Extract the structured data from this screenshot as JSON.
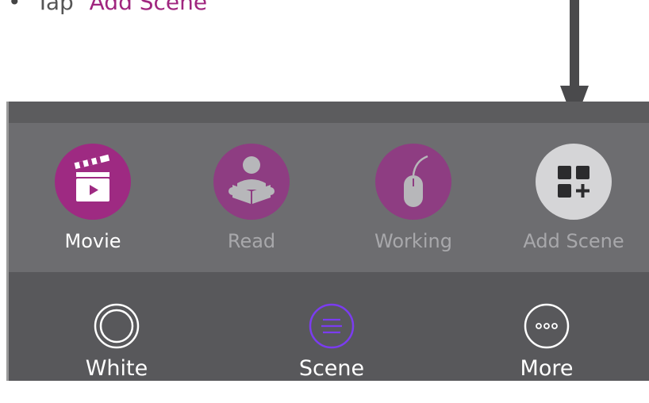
{
  "instruction": {
    "bullet": "•",
    "prefix": "Tap",
    "quoted": "“Add Scene”"
  },
  "colors": {
    "accent_magenta": "#a0267f",
    "scene_purple": "#8e3d82",
    "add_circle": "#d5d5d7",
    "selected_nav": "#7b3cf0",
    "label_active": "#ffffff",
    "label_inactive": "#a8a8ab"
  },
  "scenes": [
    {
      "label": "Movie",
      "icon": "clapperboard-icon",
      "active": true
    },
    {
      "label": "Read",
      "icon": "reading-person-icon",
      "active": false
    },
    {
      "label": "Working",
      "icon": "mouse-icon",
      "active": false
    },
    {
      "label": "Add Scene",
      "icon": "add-grid-icon",
      "active": false
    }
  ],
  "nav": [
    {
      "label": "White",
      "icon": "white-circle-icon"
    },
    {
      "label": "Scene",
      "icon": "scene-menu-icon",
      "selected": true
    },
    {
      "label": "More",
      "icon": "more-dots-icon"
    }
  ]
}
